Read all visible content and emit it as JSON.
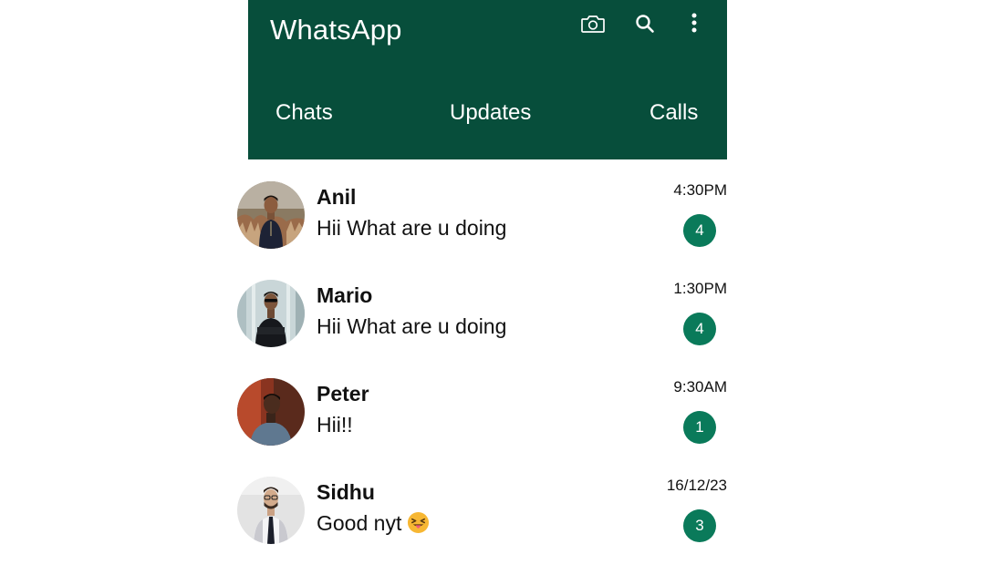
{
  "app": {
    "title": "WhatsApp",
    "header_color": "#074e3b",
    "badge_color": "#0a7a5a",
    "header_icons": [
      "camera-icon",
      "search-icon",
      "more-vertical-icon"
    ]
  },
  "tabs": [
    {
      "label": "Chats"
    },
    {
      "label": "Updates"
    },
    {
      "label": "Calls"
    }
  ],
  "chats": [
    {
      "name": "Anil",
      "message": "Hii What are u doing",
      "time": "4:30PM",
      "unread": "4"
    },
    {
      "name": "Mario",
      "message": "Hii What are u doing",
      "time": "1:30PM",
      "unread": "4"
    },
    {
      "name": "Peter",
      "message": "Hii!!",
      "time": "9:30AM",
      "unread": "1"
    },
    {
      "name": "Sidhu",
      "message": "Good nyt",
      "time": "16/12/23",
      "unread": "3",
      "emoji": "winking-tongue-face-emoji"
    }
  ]
}
